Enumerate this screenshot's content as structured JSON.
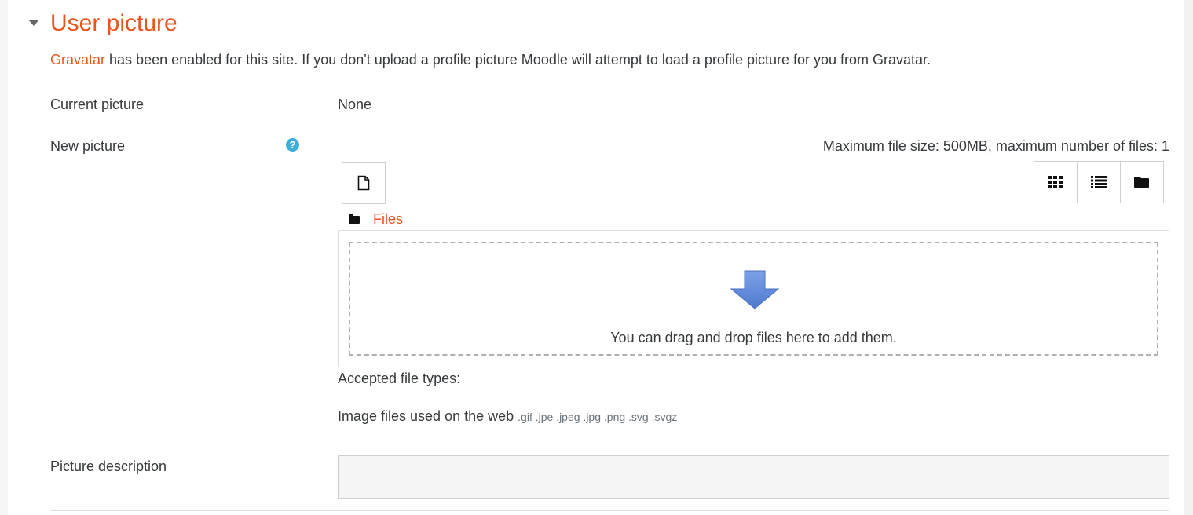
{
  "section": {
    "title": "User picture"
  },
  "intro": {
    "link_text": "Gravatar",
    "rest_text": " has been enabled for this site. If you don't upload a profile picture Moodle will attempt to load a profile picture for you from Gravatar."
  },
  "current_picture": {
    "label": "Current picture",
    "value": "None"
  },
  "new_picture": {
    "label": "New picture",
    "help_glyph": "?",
    "max_size_text": "Maximum file size: 500MB, maximum number of files: 1",
    "add_file_icon": "document-icon",
    "view_buttons": [
      "grid-view-icon",
      "list-view-icon",
      "folder-view-icon"
    ],
    "breadcrumb_label": "Files",
    "dropzone_text": "You can drag and drop files here to add them.",
    "accepted_title": "Accepted file types:",
    "accepted_group": "Image files used on the web",
    "accepted_extensions": ".gif .jpe .jpeg .jpg .png .svg .svgz"
  },
  "picture_description": {
    "label": "Picture description",
    "value": ""
  },
  "colors": {
    "accent": "#e8561e",
    "help": "#3dafd8",
    "arrow": "#5b85d6"
  }
}
